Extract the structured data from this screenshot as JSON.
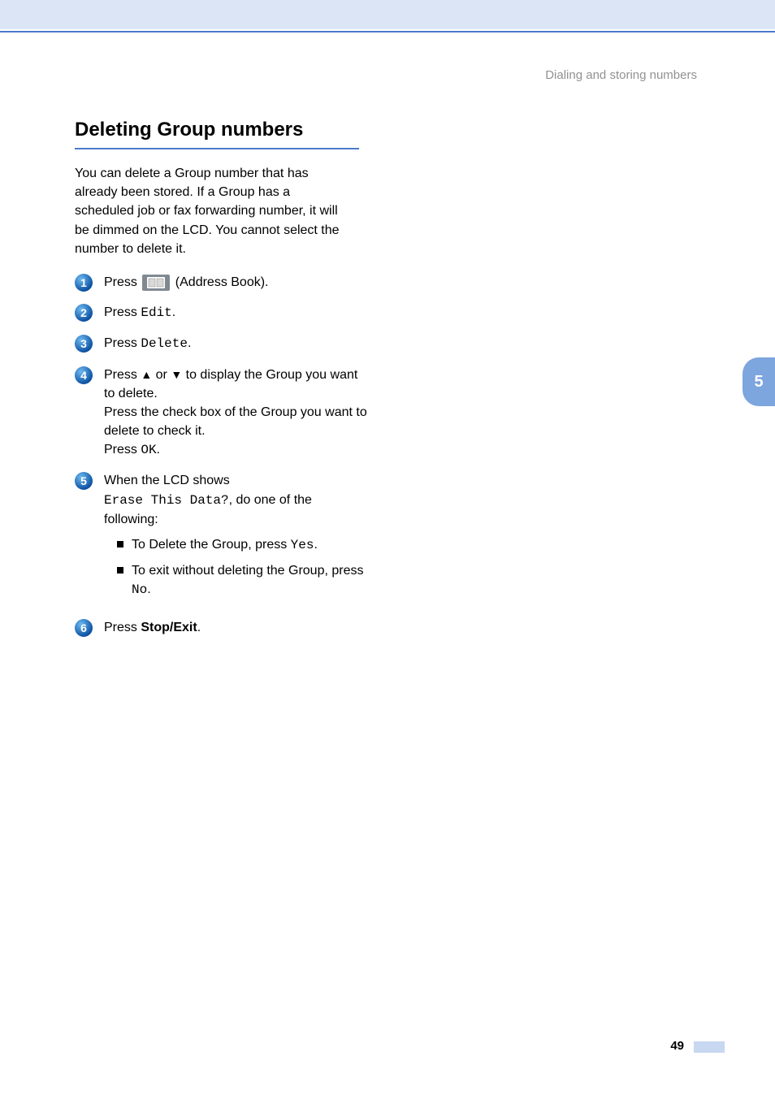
{
  "header": {
    "breadcrumb": "Dialing and storing numbers"
  },
  "title": "Deleting Group numbers",
  "intro": "You can delete a Group number that has already been stored. If a Group has a scheduled job or fax forwarding number, it will be dimmed on the LCD. You cannot select the number to delete it.",
  "steps": {
    "s1": {
      "pre": "Press ",
      "post": " (Address Book)."
    },
    "s2": {
      "pre": "Press ",
      "code": "Edit",
      "post": "."
    },
    "s3": {
      "pre": "Press ",
      "code": "Delete",
      "post": "."
    },
    "s4": {
      "l1a": "Press ",
      "l1b": " or ",
      "l1c": " to display the Group you want to delete.",
      "l2": "Press the check box of the Group you want to delete to check it.",
      "l3a": "Press ",
      "l3code": "OK",
      "l3b": "."
    },
    "s5": {
      "l1": "When the LCD shows ",
      "code": "Erase This Data?",
      "l2": ", do one of the following:",
      "b1a": "To Delete the Group, press ",
      "b1code": "Yes",
      "b1b": ".",
      "b2a": "To exit without deleting the Group, press ",
      "b2code": "No",
      "b2b": "."
    },
    "s6": {
      "pre": "Press ",
      "bold": "Stop/Exit",
      "post": "."
    }
  },
  "sideTab": "5",
  "pageNumber": "49"
}
